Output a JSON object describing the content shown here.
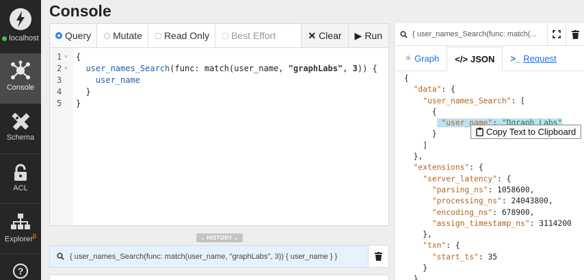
{
  "sidebar": {
    "host": "localhost",
    "items": [
      {
        "label": "Console",
        "icon": "graph-nodes-icon",
        "active": true
      },
      {
        "label": "Schema",
        "icon": "pencil-ruler-icon",
        "active": false
      },
      {
        "label": "ACL",
        "icon": "lock-icon",
        "active": false
      },
      {
        "label": "Explorer",
        "sup": "β",
        "icon": "org-chart-icon",
        "active": false
      },
      {
        "label": "",
        "icon": "help-icon",
        "active": false
      }
    ]
  },
  "page": {
    "title": "Console"
  },
  "editor": {
    "modes": [
      {
        "label": "Query",
        "selected": true
      },
      {
        "label": "Mutate",
        "selected": false
      }
    ],
    "options": [
      {
        "label": "Read Only",
        "enabled": true
      },
      {
        "label": "Best Effort",
        "enabled": false
      }
    ],
    "clear_label": "Clear",
    "run_label": "Run",
    "line_numbers": [
      "1",
      "2",
      "3",
      "4",
      "5"
    ],
    "code": {
      "l1": "{",
      "l2_fn": "user_names_Search",
      "l2_a": "(func: match(user_name, ",
      "l2_str": "\"graphLabs\"",
      "l2_b": ", ",
      "l2_num": "3",
      "l2_c": ")) {",
      "l3": "user_name",
      "l4": "}",
      "l5": "}"
    }
  },
  "history": {
    "label": "HISTORY",
    "items": [
      "{ user_names_Search(func: match(user_name, \"graphLabs\", 3)) { user_name } }"
    ]
  },
  "result": {
    "query_preview": "{ user_names_Search(func: match(...",
    "tabs": [
      {
        "label": "Graph",
        "icon": "graph-icon"
      },
      {
        "label": "JSON",
        "icon": "code-icon"
      },
      {
        "label": "Request",
        "icon": "terminal-icon"
      }
    ],
    "copy_label": "Copy Text to Clipboard",
    "json": {
      "data_key": "\"data\"",
      "search_key": "\"user_names_Search\"",
      "user_name_key": "\"user_name\"",
      "user_name_val": "\"Dgraph Labs\"",
      "extensions_key": "\"extensions\"",
      "server_latency_key": "\"server_latency\"",
      "parsing_key": "\"parsing_ns\"",
      "parsing_val": "1058600",
      "processing_key": "\"processing_ns\"",
      "processing_val": "24043800",
      "encoding_key": "\"encoding_ns\"",
      "encoding_val": "678900",
      "assign_key": "\"assign_timestamp_ns\"",
      "assign_val": "3114200",
      "txn_key": "\"txn\"",
      "start_ts_key": "\"start_ts\"",
      "start_ts_val": "35"
    }
  },
  "colors": {
    "accent": "#2f7fe0",
    "sidebar_bg": "#262626",
    "status_online": "#3fbf4a"
  }
}
